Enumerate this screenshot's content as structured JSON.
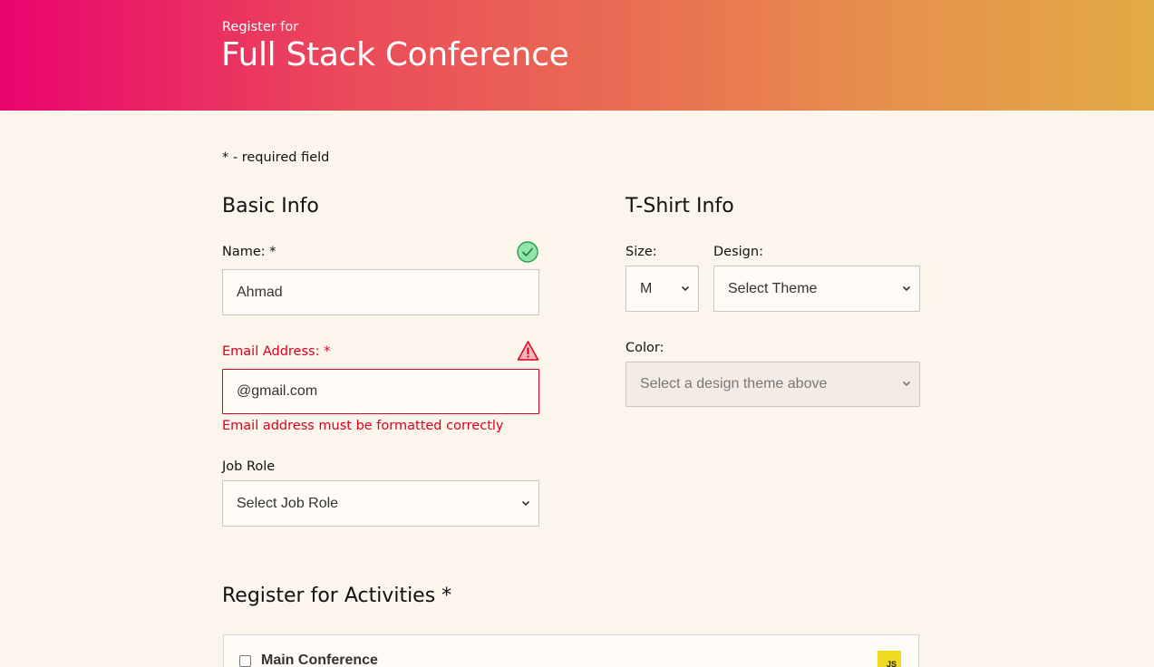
{
  "header": {
    "eyebrow": "Register for",
    "title": "Full Stack Conference"
  },
  "required_note": "* - required field",
  "basic_info": {
    "heading": "Basic Info",
    "name": {
      "label": "Name: *",
      "value": "Ahmad",
      "status": "valid"
    },
    "email": {
      "label": "Email Address: *",
      "value": "@gmail.com",
      "status": "error",
      "error_message": "Email address must be formatted correctly"
    },
    "job_role": {
      "label": "Job Role",
      "selected": "Select Job Role"
    }
  },
  "tshirt_info": {
    "heading": "T-Shirt Info",
    "size": {
      "label": "Size:",
      "selected": "M"
    },
    "design": {
      "label": "Design:",
      "selected": "Select Theme"
    },
    "color": {
      "label": "Color:",
      "selected": "Select a design theme above",
      "disabled": true
    }
  },
  "activities": {
    "heading": "Register for Activities *",
    "items": [
      {
        "label": "Main Conference",
        "checked": false,
        "badge": "JS"
      }
    ]
  },
  "colors": {
    "background": "#fcf5eb",
    "error": "#d9001e",
    "valid": "#2ecc71",
    "header_gradient_start": "#e9046d",
    "header_gradient_end": "#e2ab44"
  }
}
